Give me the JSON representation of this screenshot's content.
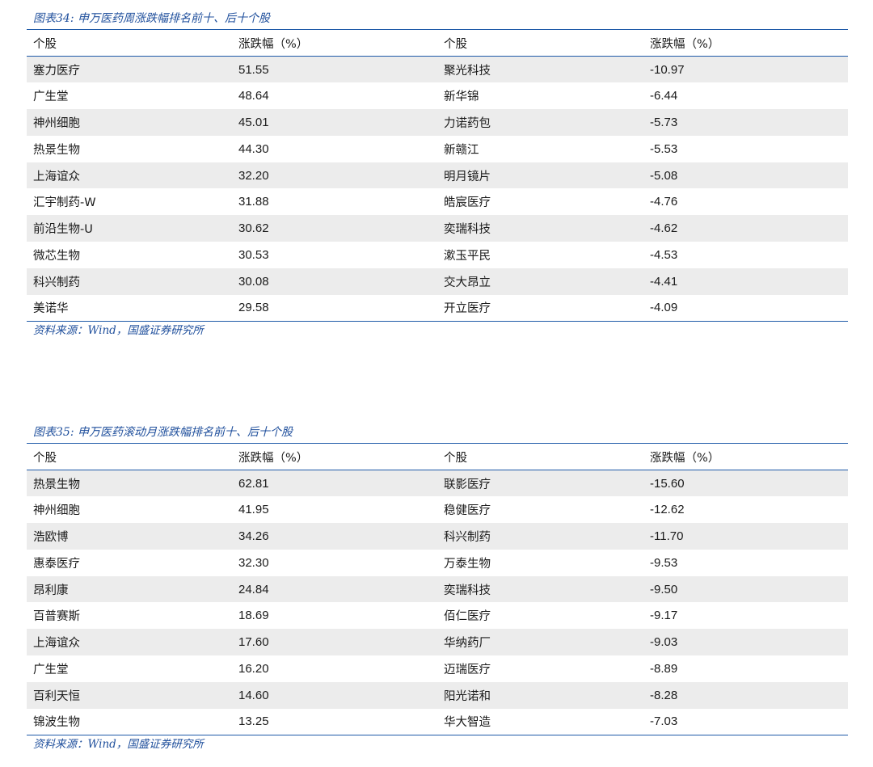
{
  "tables": [
    {
      "caption": "图表34:  申万医药周涨跌幅排名前十、后十个股",
      "headers": [
        "个股",
        "涨跌幅（%）",
        "个股",
        "涨跌幅（%）"
      ],
      "rows": [
        [
          "塞力医疗",
          "51.55",
          "聚光科技",
          "-10.97"
        ],
        [
          "广生堂",
          "48.64",
          "新华锦",
          "-6.44"
        ],
        [
          "神州细胞",
          "45.01",
          "力诺药包",
          "-5.73"
        ],
        [
          "热景生物",
          "44.30",
          "新赣江",
          "-5.53"
        ],
        [
          "上海谊众",
          "32.20",
          "明月镜片",
          "-5.08"
        ],
        [
          "汇宇制药-W",
          "31.88",
          "皓宸医疗",
          "-4.76"
        ],
        [
          "前沿生物-U",
          "30.62",
          "奕瑞科技",
          "-4.62"
        ],
        [
          "微芯生物",
          "30.53",
          "漱玉平民",
          "-4.53"
        ],
        [
          "科兴制药",
          "30.08",
          "交大昂立",
          "-4.41"
        ],
        [
          "美诺华",
          "29.58",
          "开立医疗",
          "-4.09"
        ]
      ],
      "source": "资料来源：Wind，国盛证券研究所"
    },
    {
      "caption": "图表35:  申万医药滚动月涨跌幅排名前十、后十个股",
      "headers": [
        "个股",
        "涨跌幅（%）",
        "个股",
        "涨跌幅（%）"
      ],
      "rows": [
        [
          "热景生物",
          "62.81",
          "联影医疗",
          "-15.60"
        ],
        [
          "神州细胞",
          "41.95",
          "稳健医疗",
          "-12.62"
        ],
        [
          "浩欧博",
          "34.26",
          "科兴制药",
          "-11.70"
        ],
        [
          "惠泰医疗",
          "32.30",
          "万泰生物",
          "-9.53"
        ],
        [
          "昂利康",
          "24.84",
          "奕瑞科技",
          "-9.50"
        ],
        [
          "百普赛斯",
          "18.69",
          "佰仁医疗",
          "-9.17"
        ],
        [
          "上海谊众",
          "17.60",
          "华纳药厂",
          "-9.03"
        ],
        [
          "广生堂",
          "16.20",
          "迈瑞医疗",
          "-8.89"
        ],
        [
          "百利天恒",
          "14.60",
          "阳光诺和",
          "-8.28"
        ],
        [
          "锦波生物",
          "13.25",
          "华大智造",
          "-7.03"
        ]
      ],
      "source": "资料来源：Wind，国盛证券研究所"
    }
  ]
}
